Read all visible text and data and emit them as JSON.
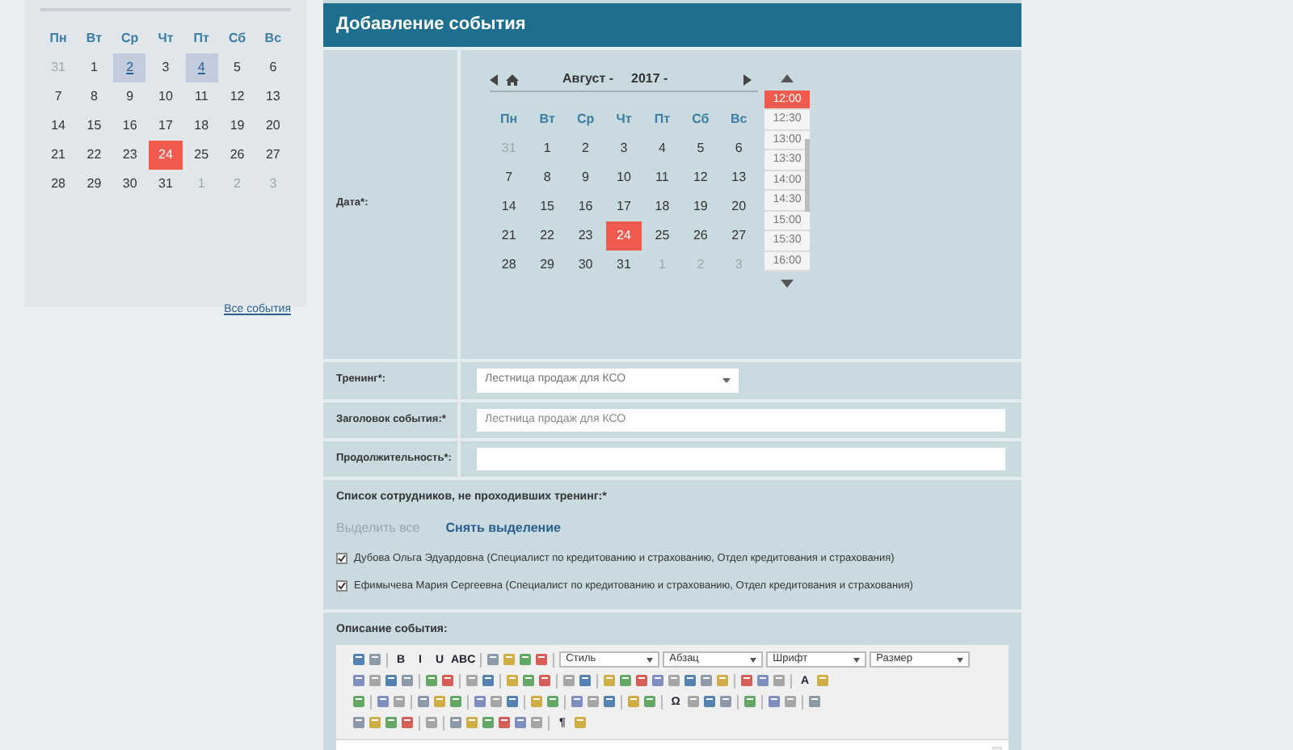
{
  "mini_calendar": {
    "weekdays": [
      "Пн",
      "Вт",
      "Ср",
      "Чт",
      "Пт",
      "Сб",
      "Вс"
    ],
    "days": [
      {
        "label": "31",
        "kind": "other"
      },
      {
        "label": "1",
        "kind": "normal"
      },
      {
        "label": "2",
        "kind": "event"
      },
      {
        "label": "3",
        "kind": "normal"
      },
      {
        "label": "4",
        "kind": "event"
      },
      {
        "label": "5",
        "kind": "normal"
      },
      {
        "label": "6",
        "kind": "normal"
      },
      {
        "label": "7",
        "kind": "normal"
      },
      {
        "label": "8",
        "kind": "normal"
      },
      {
        "label": "9",
        "kind": "normal"
      },
      {
        "label": "10",
        "kind": "normal"
      },
      {
        "label": "11",
        "kind": "normal"
      },
      {
        "label": "12",
        "kind": "normal"
      },
      {
        "label": "13",
        "kind": "normal"
      },
      {
        "label": "14",
        "kind": "normal"
      },
      {
        "label": "15",
        "kind": "normal"
      },
      {
        "label": "16",
        "kind": "normal"
      },
      {
        "label": "17",
        "kind": "normal"
      },
      {
        "label": "18",
        "kind": "normal"
      },
      {
        "label": "19",
        "kind": "normal"
      },
      {
        "label": "20",
        "kind": "normal"
      },
      {
        "label": "21",
        "kind": "normal"
      },
      {
        "label": "22",
        "kind": "normal"
      },
      {
        "label": "23",
        "kind": "normal"
      },
      {
        "label": "24",
        "kind": "today"
      },
      {
        "label": "25",
        "kind": "normal"
      },
      {
        "label": "26",
        "kind": "normal"
      },
      {
        "label": "27",
        "kind": "normal"
      },
      {
        "label": "28",
        "kind": "normal"
      },
      {
        "label": "29",
        "kind": "normal"
      },
      {
        "label": "30",
        "kind": "normal"
      },
      {
        "label": "31",
        "kind": "normal"
      },
      {
        "label": "1",
        "kind": "other"
      },
      {
        "label": "2",
        "kind": "other"
      },
      {
        "label": "3",
        "kind": "other"
      }
    ],
    "all_events_link": "Все события"
  },
  "form": {
    "title": "Добавление события",
    "date_field": {
      "label": "Дата*:",
      "month": "Август -",
      "year": "2017 -",
      "weekdays": [
        "Пн",
        "Вт",
        "Ср",
        "Чт",
        "Пт",
        "Сб",
        "Вс"
      ],
      "days": [
        {
          "label": "31",
          "kind": "other"
        },
        {
          "label": "1",
          "kind": "normal"
        },
        {
          "label": "2",
          "kind": "normal"
        },
        {
          "label": "3",
          "kind": "normal"
        },
        {
          "label": "4",
          "kind": "normal"
        },
        {
          "label": "5",
          "kind": "normal"
        },
        {
          "label": "6",
          "kind": "normal"
        },
        {
          "label": "7",
          "kind": "normal"
        },
        {
          "label": "8",
          "kind": "normal"
        },
        {
          "label": "9",
          "kind": "normal"
        },
        {
          "label": "10",
          "kind": "normal"
        },
        {
          "label": "11",
          "kind": "normal"
        },
        {
          "label": "12",
          "kind": "normal"
        },
        {
          "label": "13",
          "kind": "normal"
        },
        {
          "label": "14",
          "kind": "normal"
        },
        {
          "label": "15",
          "kind": "normal"
        },
        {
          "label": "16",
          "kind": "normal"
        },
        {
          "label": "17",
          "kind": "normal"
        },
        {
          "label": "18",
          "kind": "normal"
        },
        {
          "label": "19",
          "kind": "normal"
        },
        {
          "label": "20",
          "kind": "normal"
        },
        {
          "label": "21",
          "kind": "normal"
        },
        {
          "label": "22",
          "kind": "normal"
        },
        {
          "label": "23",
          "kind": "normal"
        },
        {
          "label": "24",
          "kind": "today"
        },
        {
          "label": "25",
          "kind": "normal"
        },
        {
          "label": "26",
          "kind": "normal"
        },
        {
          "label": "27",
          "kind": "normal"
        },
        {
          "label": "28",
          "kind": "normal"
        },
        {
          "label": "29",
          "kind": "normal"
        },
        {
          "label": "30",
          "kind": "normal"
        },
        {
          "label": "31",
          "kind": "normal"
        },
        {
          "label": "1",
          "kind": "other"
        },
        {
          "label": "2",
          "kind": "other"
        },
        {
          "label": "3",
          "kind": "other"
        }
      ],
      "times": [
        {
          "label": "12:00",
          "selected": true
        },
        {
          "label": "12:30",
          "selected": false
        },
        {
          "label": "13:00",
          "selected": false
        },
        {
          "label": "13:30",
          "selected": false
        },
        {
          "label": "14:00",
          "selected": false
        },
        {
          "label": "14:30",
          "selected": false
        },
        {
          "label": "15:00",
          "selected": false
        },
        {
          "label": "15:30",
          "selected": false
        },
        {
          "label": "16:00",
          "selected": false
        }
      ]
    },
    "training": {
      "label": "Тренинг*:",
      "value": "Лестница продаж для КСО"
    },
    "event_title": {
      "label": "Заголовок события:*",
      "placeholder": "Лестница продаж для КСО"
    },
    "duration": {
      "label": "Продолжительность*:"
    },
    "employees": {
      "label": "Список сотрудников, не проходивших тренинг:*",
      "select_all": {
        "text": "Выделить все",
        "disabled": true
      },
      "deselect": {
        "text": "Снять выделение",
        "disabled": false
      },
      "items": [
        {
          "name": "Дубова Ольга Эдуардовна (Специалист по кредитованию и страхованию, Отдел кредитования и страхования)",
          "checked": true
        },
        {
          "name": "Ефимычева Мария Сергеевна (Специалист по кредитованию и страхованию, Отдел кредитования и страхования)",
          "checked": true
        }
      ]
    },
    "description": {
      "label": "Описание события:",
      "toolbar": [
        [
          {
            "kind": "icon"
          },
          {
            "kind": "icon"
          },
          {
            "kind": "sep"
          },
          {
            "kind": "text",
            "text": "B"
          },
          {
            "kind": "text",
            "text": "I"
          },
          {
            "kind": "text",
            "text": "U"
          },
          {
            "kind": "text",
            "text": "ABC"
          },
          {
            "kind": "sep"
          },
          {
            "kind": "icon"
          },
          {
            "kind": "icon"
          },
          {
            "kind": "icon"
          },
          {
            "kind": "icon"
          },
          {
            "kind": "sep"
          },
          {
            "kind": "select",
            "text": "Стиль"
          },
          {
            "kind": "select",
            "text": "Абзац"
          },
          {
            "kind": "select",
            "text": "Шрифт"
          },
          {
            "kind": "select",
            "text": "Размер"
          }
        ],
        [
          {
            "kind": "icon"
          },
          {
            "kind": "icon"
          },
          {
            "kind": "icon"
          },
          {
            "kind": "icon"
          },
          {
            "kind": "sep"
          },
          {
            "kind": "icon"
          },
          {
            "kind": "icon"
          },
          {
            "kind": "sep"
          },
          {
            "kind": "icon"
          },
          {
            "kind": "icon"
          },
          {
            "kind": "sep"
          },
          {
            "kind": "icon"
          },
          {
            "kind": "icon"
          },
          {
            "kind": "icon"
          },
          {
            "kind": "sep"
          },
          {
            "kind": "icon"
          },
          {
            "kind": "icon"
          },
          {
            "kind": "sep"
          },
          {
            "kind": "icon"
          },
          {
            "kind": "icon"
          },
          {
            "kind": "icon"
          },
          {
            "kind": "icon"
          },
          {
            "kind": "icon"
          },
          {
            "kind": "icon"
          },
          {
            "kind": "icon"
          },
          {
            "kind": "icon"
          },
          {
            "kind": "sep"
          },
          {
            "kind": "icon"
          },
          {
            "kind": "icon"
          },
          {
            "kind": "icon"
          },
          {
            "kind": "sep"
          },
          {
            "kind": "text",
            "text": "A"
          },
          {
            "kind": "icon"
          }
        ],
        [
          {
            "kind": "icon"
          },
          {
            "kind": "sep"
          },
          {
            "kind": "icon"
          },
          {
            "kind": "icon"
          },
          {
            "kind": "sep"
          },
          {
            "kind": "icon"
          },
          {
            "kind": "icon"
          },
          {
            "kind": "icon"
          },
          {
            "kind": "sep"
          },
          {
            "kind": "icon"
          },
          {
            "kind": "icon"
          },
          {
            "kind": "icon"
          },
          {
            "kind": "sep"
          },
          {
            "kind": "icon"
          },
          {
            "kind": "icon"
          },
          {
            "kind": "sep"
          },
          {
            "kind": "icon"
          },
          {
            "kind": "icon"
          },
          {
            "kind": "icon"
          },
          {
            "kind": "sep"
          },
          {
            "kind": "icon"
          },
          {
            "kind": "icon"
          },
          {
            "kind": "sep"
          },
          {
            "kind": "text",
            "text": "Ω"
          },
          {
            "kind": "icon"
          },
          {
            "kind": "icon"
          },
          {
            "kind": "icon"
          },
          {
            "kind": "sep"
          },
          {
            "kind": "icon"
          },
          {
            "kind": "sep"
          },
          {
            "kind": "icon"
          },
          {
            "kind": "icon"
          },
          {
            "kind": "sep"
          },
          {
            "kind": "icon"
          }
        ],
        [
          {
            "kind": "icon"
          },
          {
            "kind": "icon"
          },
          {
            "kind": "icon"
          },
          {
            "kind": "icon"
          },
          {
            "kind": "sep"
          },
          {
            "kind": "icon"
          },
          {
            "kind": "sep"
          },
          {
            "kind": "icon"
          },
          {
            "kind": "icon"
          },
          {
            "kind": "icon"
          },
          {
            "kind": "icon"
          },
          {
            "kind": "icon"
          },
          {
            "kind": "icon"
          },
          {
            "kind": "sep"
          },
          {
            "kind": "text",
            "text": "¶"
          },
          {
            "kind": "icon"
          }
        ]
      ]
    }
  }
}
